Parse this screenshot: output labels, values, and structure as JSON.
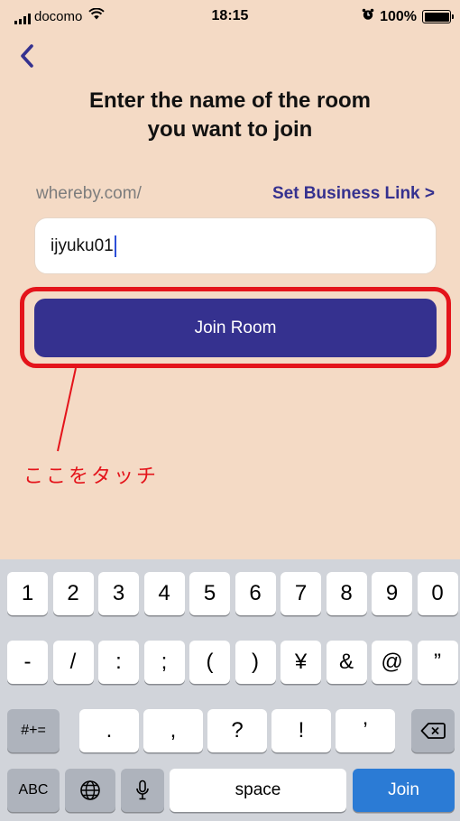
{
  "status_bar": {
    "carrier": "docomo",
    "time": "18:15",
    "battery": "100%",
    "battery_level": 1.0
  },
  "nav": {
    "back_icon": "chevron-left-icon"
  },
  "title": {
    "line1": "Enter the name of the room",
    "line2": "you want to join"
  },
  "room": {
    "prefix": "whereby.com/",
    "business_link": "Set Business Link >",
    "value": "ijyuku01"
  },
  "join_button": {
    "label": "Join Room"
  },
  "annotation": {
    "text": "ここをタッチ",
    "color": "#e4141b"
  },
  "keyboard": {
    "row1": [
      "1",
      "2",
      "3",
      "4",
      "5",
      "6",
      "7",
      "8",
      "9",
      "0"
    ],
    "row2": [
      "-",
      "/",
      ":",
      ";",
      "(",
      ")",
      "¥",
      "&",
      "@",
      "”"
    ],
    "row3_toggle": "#+=",
    "row3": [
      ".",
      ",",
      "?",
      "!",
      "’"
    ],
    "abc": "ABC",
    "space": "space",
    "join": "Join"
  },
  "colors": {
    "background": "#f4dac5",
    "accent": "#35318f",
    "keyboard_join": "#2b7bd5"
  }
}
